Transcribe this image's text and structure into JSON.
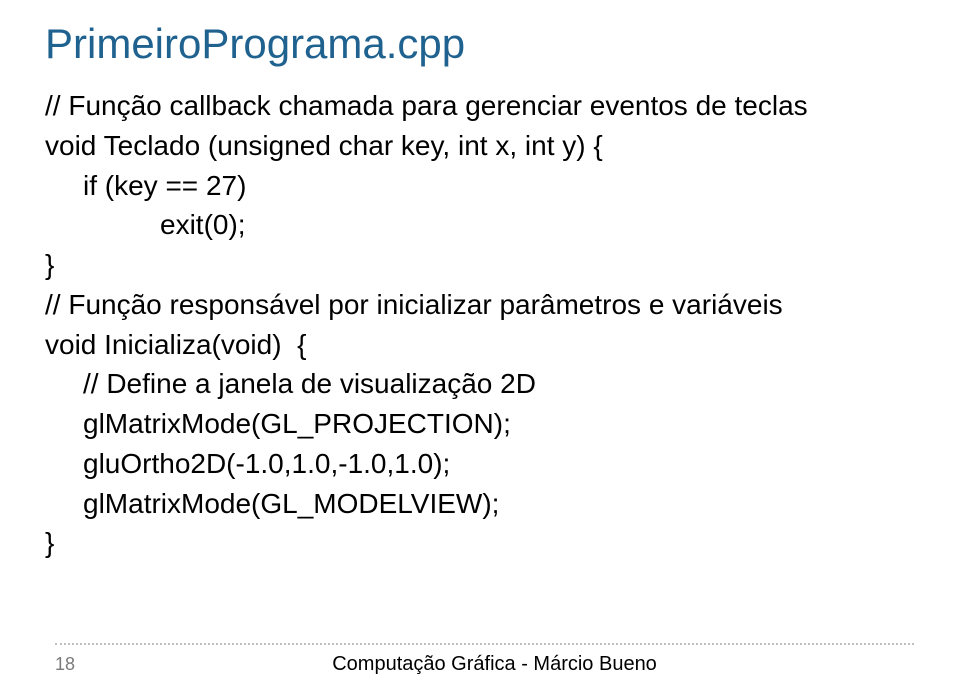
{
  "title": "PrimeiroPrograma.cpp",
  "code": {
    "line1": "// Função callback chamada para gerenciar eventos de teclas",
    "line2": "void Teclado (unsigned char key, int x, int y) {",
    "line3": "if (key == 27)",
    "line4": "exit(0);",
    "line5": "}",
    "line6": "// Função responsável por inicializar parâmetros e variáveis",
    "line7": "void Inicializa(void)  {",
    "line8": "// Define a janela de visualização 2D",
    "line9": "glMatrixMode(GL_PROJECTION);",
    "line10": "gluOrtho2D(-1.0,1.0,-1.0,1.0);",
    "line11": "glMatrixMode(GL_MODELVIEW);",
    "line12": "}"
  },
  "footer": {
    "page_number": "18",
    "text": "Computação Gráfica - Márcio Bueno"
  }
}
